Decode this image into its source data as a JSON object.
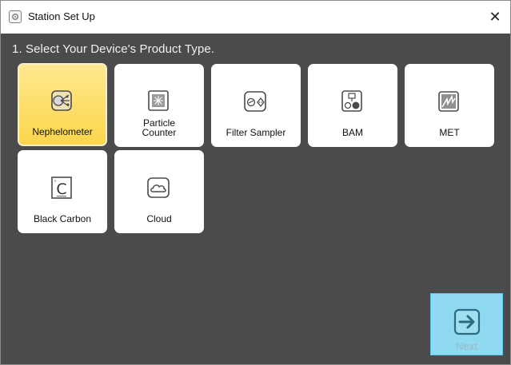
{
  "window": {
    "title": "Station Set Up",
    "close_glyph": "✕"
  },
  "step": {
    "heading": "1. Select Your Device's Product Type."
  },
  "tiles": [
    {
      "label": "Nephelometer",
      "icon": "nephelometer-icon",
      "selected": true
    },
    {
      "label_line1": "Particle",
      "label_line2": "Counter",
      "icon": "particle-counter-icon",
      "selected": false
    },
    {
      "label": "Filter Sampler",
      "icon": "filter-sampler-icon",
      "selected": false
    },
    {
      "label": "BAM",
      "icon": "bam-icon",
      "selected": false
    },
    {
      "label": "MET",
      "icon": "met-icon",
      "selected": false
    },
    {
      "label": "Black Carbon",
      "icon": "black-carbon-icon",
      "selected": false
    },
    {
      "label": "Cloud",
      "icon": "cloud-icon",
      "selected": false
    }
  ],
  "next": {
    "label": "Next",
    "enabled": false
  },
  "colors": {
    "background": "#4b4b4b",
    "selected_tile": "#fbd64b",
    "next_button": "#8fdaf0"
  }
}
